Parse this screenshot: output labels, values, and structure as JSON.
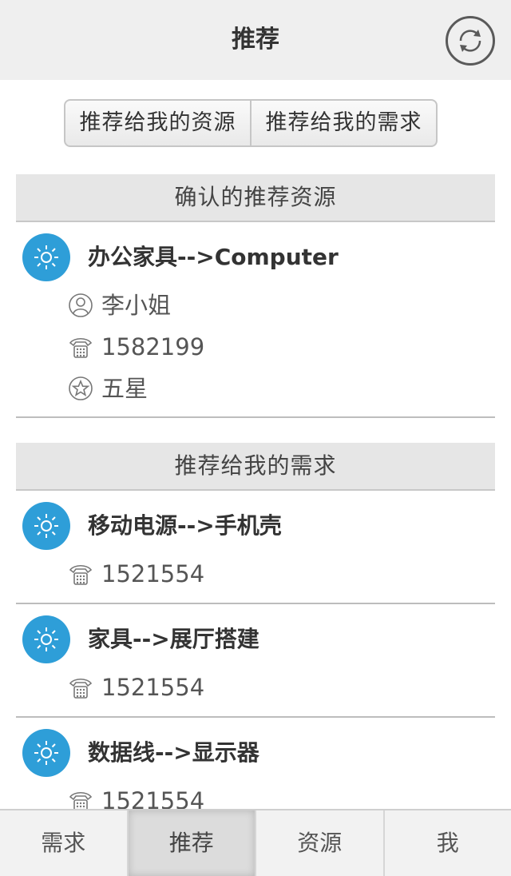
{
  "header": {
    "title": "推荐",
    "refresh_icon": "refresh-icon"
  },
  "segment": {
    "resources_label": "推荐给我的资源",
    "needs_label": "推荐给我的需求"
  },
  "confirmed": {
    "section_title": "确认的推荐资源",
    "items": [
      {
        "title": "办公家具-->Computer",
        "contact": "李小姐",
        "phone": "1582199",
        "rating": "五星",
        "icon": "sun-icon"
      }
    ]
  },
  "recommended_needs": {
    "section_title": "推荐给我的需求",
    "items": [
      {
        "title": "移动电源-->手机壳",
        "phone": "1521554",
        "icon": "sun-icon"
      },
      {
        "title": "家具-->展厅搭建",
        "phone": "1521554",
        "icon": "sun-icon"
      },
      {
        "title": "数据线-->显示器",
        "phone": "1521554",
        "icon": "sun-icon"
      }
    ]
  },
  "tabbar": {
    "tabs": [
      {
        "label": "需求",
        "active": false
      },
      {
        "label": "推荐",
        "active": true
      },
      {
        "label": "资源",
        "active": false
      },
      {
        "label": "我",
        "active": false
      }
    ]
  },
  "colors": {
    "accent": "#2e9ed8",
    "header_bg": "#efefef",
    "section_bg": "#e6e6e6"
  }
}
